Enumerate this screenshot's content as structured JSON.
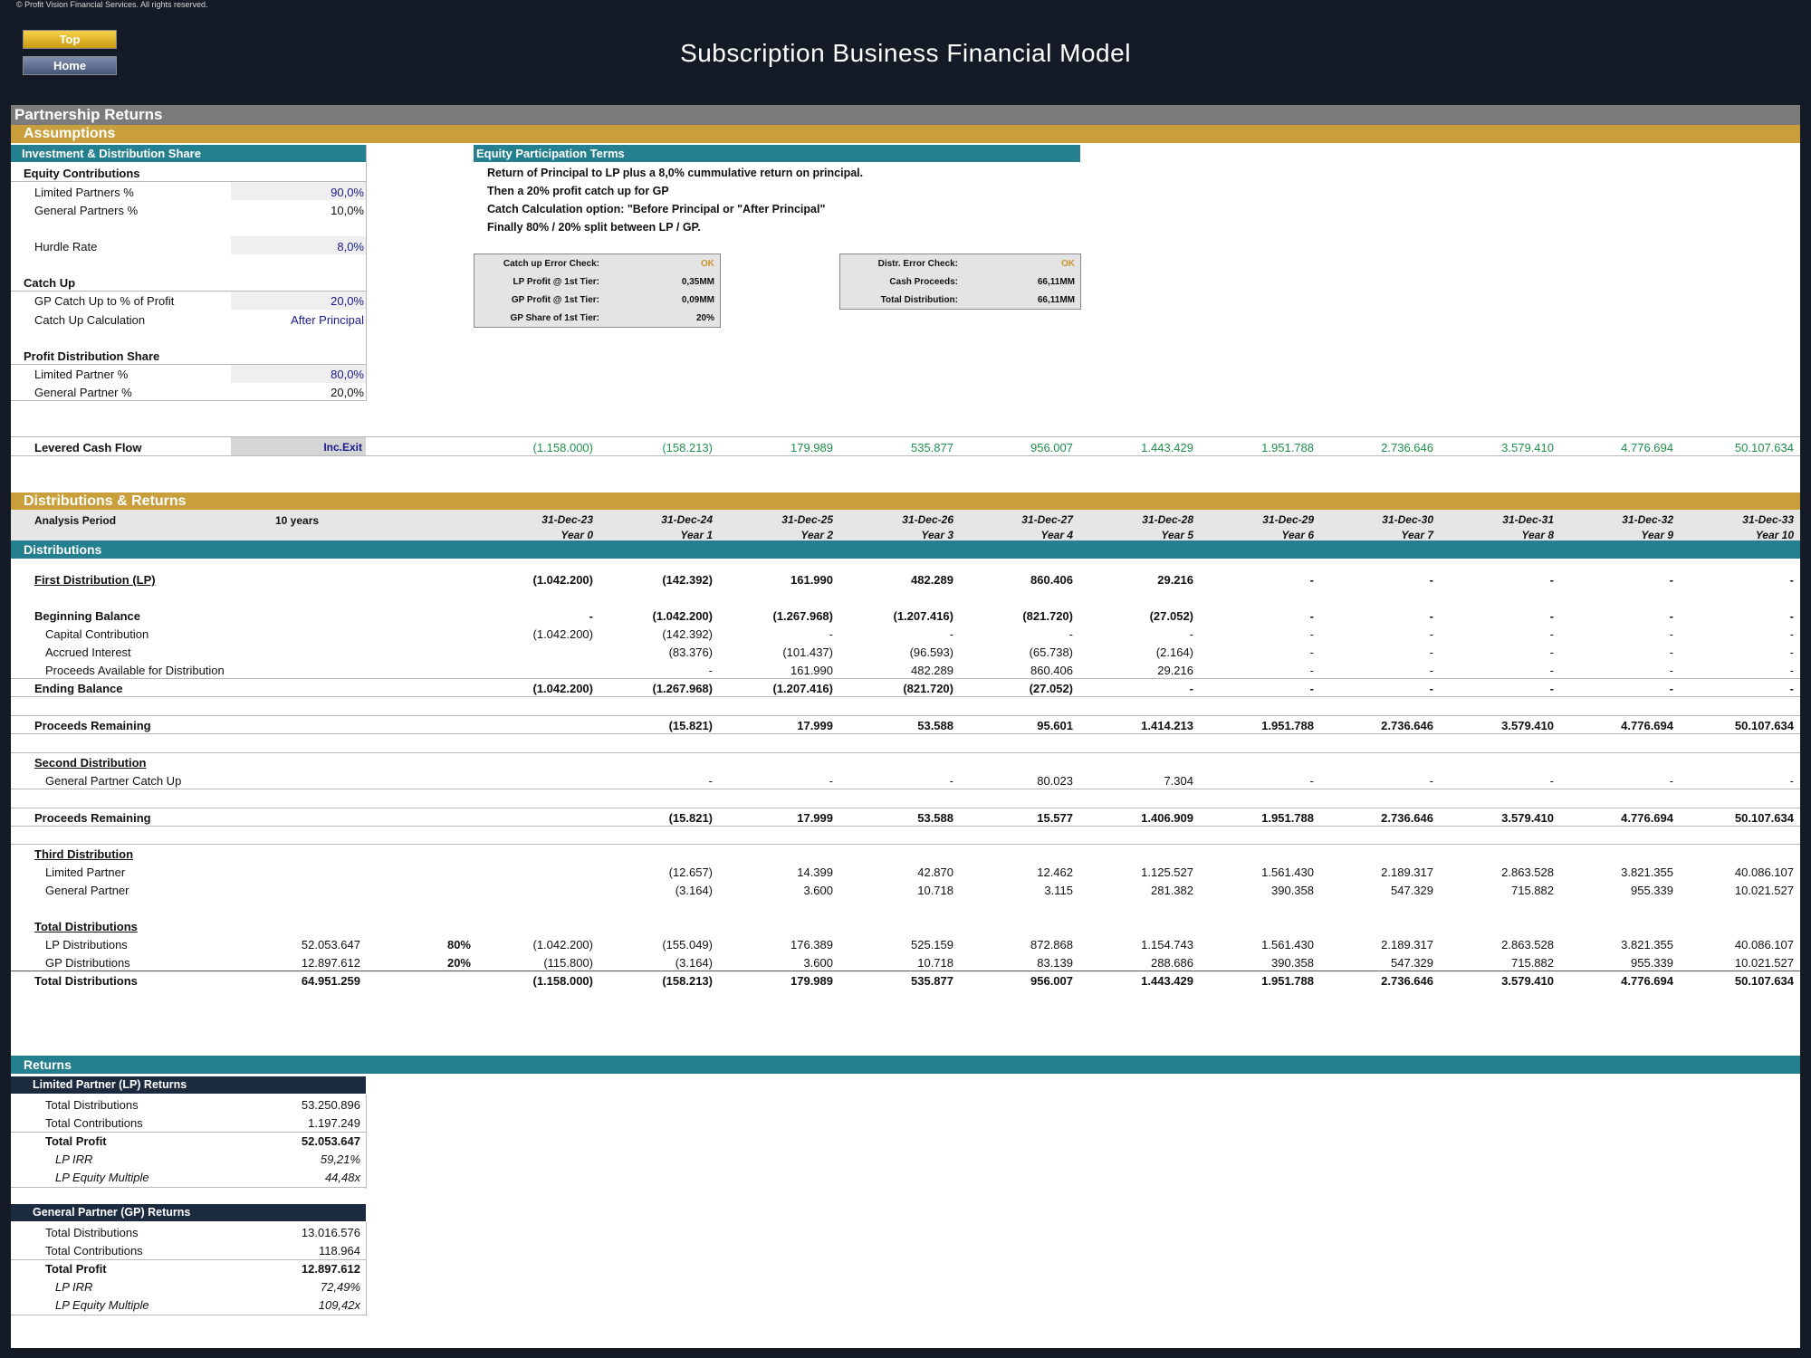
{
  "copyright": "© Profit Vision Financial Services. All rights reserved.",
  "nav": {
    "top_label": "Top",
    "home_label": "Home"
  },
  "title": "Subscription Business Financial Model",
  "section_title": "Partnership Returns",
  "assumptions_title": "Assumptions",
  "investment": {
    "header": "Investment & Distribution Share",
    "equity_contributions": "Equity Contributions",
    "lp_pct_label": "Limited Partners %",
    "lp_pct": "90,0%",
    "gp_pct_label": "General Partners %",
    "gp_pct": "10,0%",
    "hurdle_label": "Hurdle Rate",
    "hurdle": "8,0%",
    "catch_up": "Catch Up",
    "catch_up_pct_label": "GP Catch Up to % of Profit",
    "catch_up_pct": "20,0%",
    "catch_up_calc_label": "Catch Up Calculation",
    "catch_up_calc": "After Principal",
    "profit_share": "Profit Distribution Share",
    "lp_share_label": "Limited Partner %",
    "lp_share": "80,0%",
    "gp_share_label": "General Partner %",
    "gp_share": "20,0%"
  },
  "terms": {
    "header": "Equity Participation Terms",
    "line1": "Return of Principal to LP plus a 8,0% cummulative return on principal.",
    "line2": "Then a 20% profit catch up for GP",
    "line3": "Catch Calculation option: \"Before Principal or \"After Principal\"",
    "line4": "Finally 80% / 20% split between LP / GP."
  },
  "check1": {
    "r1_label": "Catch up Error Check:",
    "r1_value": "OK",
    "r2_label": "LP Profit @ 1st Tier:",
    "r2_value": "0,35MM",
    "r3_label": "GP Profit @ 1st Tier:",
    "r3_value": "0,09MM",
    "r4_label": "GP Share of 1st Tier:",
    "r4_value": "20%"
  },
  "check2": {
    "r1_label": "Distr. Error Check:",
    "r1_value": "OK",
    "r2_label": "Cash Proceeds:",
    "r2_value": "66,11MM",
    "r3_label": "Total Distribution:",
    "r3_value": "66,11MM"
  },
  "levered": {
    "label": "Levered Cash Flow",
    "tag": "Inc.Exit",
    "values": [
      "(1.158.000)",
      "(158.213)",
      "179.989",
      "535.877",
      "956.007",
      "1.443.429",
      "1.951.788",
      "2.736.646",
      "3.579.410",
      "4.776.694",
      "50.107.634"
    ]
  },
  "dist_title": "Distributions & Returns",
  "analysis": {
    "label": "Analysis Period",
    "value": "10 years",
    "dates": [
      "31-Dec-23",
      "31-Dec-24",
      "31-Dec-25",
      "31-Dec-26",
      "31-Dec-27",
      "31-Dec-28",
      "31-Dec-29",
      "31-Dec-30",
      "31-Dec-31",
      "31-Dec-32",
      "31-Dec-33"
    ],
    "years": [
      "Year 0",
      "Year 1",
      "Year 2",
      "Year 3",
      "Year 4",
      "Year 5",
      "Year 6",
      "Year 7",
      "Year 8",
      "Year 9",
      "Year 10"
    ]
  },
  "distributions_title": "Distributions",
  "rows": [
    {
      "label": "First Distribution (LP)",
      "style": "bu",
      "values": [
        "(1.042.200)",
        "(142.392)",
        "161.990",
        "482.289",
        "860.406",
        "29.216",
        "-",
        "-",
        "-",
        "-",
        "-"
      ]
    },
    {
      "label": "Beginning Balance",
      "style": "b",
      "values": [
        "-",
        "(1.042.200)",
        "(1.267.968)",
        "(1.207.416)",
        "(821.720)",
        "(27.052)",
        "-",
        "-",
        "-",
        "-",
        "-"
      ]
    },
    {
      "label": "Capital Contribution",
      "style": "i",
      "values": [
        "(1.042.200)",
        "(142.392)",
        "-",
        "-",
        "-",
        "-",
        "-",
        "-",
        "-",
        "-",
        "-"
      ]
    },
    {
      "label": "Accrued Interest",
      "style": "i",
      "values": [
        "",
        "(83.376)",
        "(101.437)",
        "(96.593)",
        "(65.738)",
        "(2.164)",
        "-",
        "-",
        "-",
        "-",
        "-"
      ]
    },
    {
      "label": "Proceeds Available for Distribution",
      "style": "i",
      "values": [
        "",
        "-",
        "161.990",
        "482.289",
        "860.406",
        "29.216",
        "-",
        "-",
        "-",
        "-",
        "-"
      ]
    },
    {
      "label": "Ending Balance",
      "style": "b",
      "values": [
        "(1.042.200)",
        "(1.267.968)",
        "(1.207.416)",
        "(821.720)",
        "(27.052)",
        "-",
        "-",
        "-",
        "-",
        "-",
        "-"
      ]
    },
    {
      "label": "Proceeds Remaining",
      "style": "b",
      "values": [
        "",
        "(15.821)",
        "17.999",
        "53.588",
        "95.601",
        "1.414.213",
        "1.951.788",
        "2.736.646",
        "3.579.410",
        "4.776.694",
        "50.107.634"
      ]
    },
    {
      "label": "Second Distribution",
      "style": "bu",
      "values": [
        "",
        "",
        "",
        "",
        "",
        "",
        "",
        "",
        "",
        "",
        ""
      ]
    },
    {
      "label": "General Partner Catch Up",
      "style": "i",
      "values": [
        "",
        "-",
        "-",
        "-",
        "80.023",
        "7.304",
        "-",
        "-",
        "-",
        "-",
        "-"
      ]
    },
    {
      "label": "Proceeds Remaining",
      "style": "b",
      "values": [
        "",
        "(15.821)",
        "17.999",
        "53.588",
        "15.577",
        "1.406.909",
        "1.951.788",
        "2.736.646",
        "3.579.410",
        "4.776.694",
        "50.107.634"
      ]
    },
    {
      "label": "Third Distribution",
      "style": "bu",
      "values": [
        "",
        "",
        "",
        "",
        "",
        "",
        "",
        "",
        "",
        "",
        ""
      ]
    },
    {
      "label": "Limited Partner",
      "style": "i",
      "values": [
        "",
        "(12.657)",
        "14.399",
        "42.870",
        "12.462",
        "1.125.527",
        "1.561.430",
        "2.189.317",
        "2.863.528",
        "3.821.355",
        "40.086.107"
      ]
    },
    {
      "label": "General Partner",
      "style": "i",
      "values": [
        "",
        "(3.164)",
        "3.600",
        "10.718",
        "3.115",
        "281.382",
        "390.358",
        "547.329",
        "715.882",
        "955.339",
        "10.021.527"
      ]
    },
    {
      "label": "Total Distributions",
      "style": "bu",
      "values": [
        "",
        "",
        "",
        "",
        "",
        "",
        "",
        "",
        "",
        "",
        ""
      ]
    },
    {
      "label": "LP Distributions",
      "style": "i",
      "total": "52.053.647",
      "pct": "80%",
      "values": [
        "(1.042.200)",
        "(155.049)",
        "176.389",
        "525.159",
        "872.868",
        "1.154.743",
        "1.561.430",
        "2.189.317",
        "2.863.528",
        "3.821.355",
        "40.086.107"
      ]
    },
    {
      "label": "GP Distributions",
      "style": "i",
      "total": "12.897.612",
      "pct": "20%",
      "values": [
        "(115.800)",
        "(3.164)",
        "3.600",
        "10.718",
        "83.139",
        "288.686",
        "390.358",
        "547.329",
        "715.882",
        "955.339",
        "10.021.527"
      ]
    },
    {
      "label": "Total Distributions",
      "style": "b",
      "total": "64.951.259",
      "values": [
        "(1.158.000)",
        "(158.213)",
        "179.989",
        "535.877",
        "956.007",
        "1.443.429",
        "1.951.788",
        "2.736.646",
        "3.579.410",
        "4.776.694",
        "50.107.634"
      ]
    }
  ],
  "returns_title": "Returns",
  "lp_returns": {
    "header": "Limited Partner (LP) Returns",
    "rows": [
      {
        "label": "Total Distributions",
        "value": "53.250.896"
      },
      {
        "label": "Total Contributions",
        "value": "1.197.249"
      },
      {
        "label": "Total Profit",
        "value": "52.053.647"
      },
      {
        "label": "LP IRR",
        "value": "59,21%"
      },
      {
        "label": "LP Equity Multiple",
        "value": "44,48x"
      }
    ]
  },
  "gp_returns": {
    "header": "General Partner (GP) Returns",
    "rows": [
      {
        "label": "Total Distributions",
        "value": "13.016.576"
      },
      {
        "label": "Total Contributions",
        "value": "118.964"
      },
      {
        "label": "Total Profit",
        "value": "12.897.612"
      },
      {
        "label": "LP IRR",
        "value": "72,49%"
      },
      {
        "label": "LP Equity Multiple",
        "value": "109,42x"
      }
    ]
  }
}
